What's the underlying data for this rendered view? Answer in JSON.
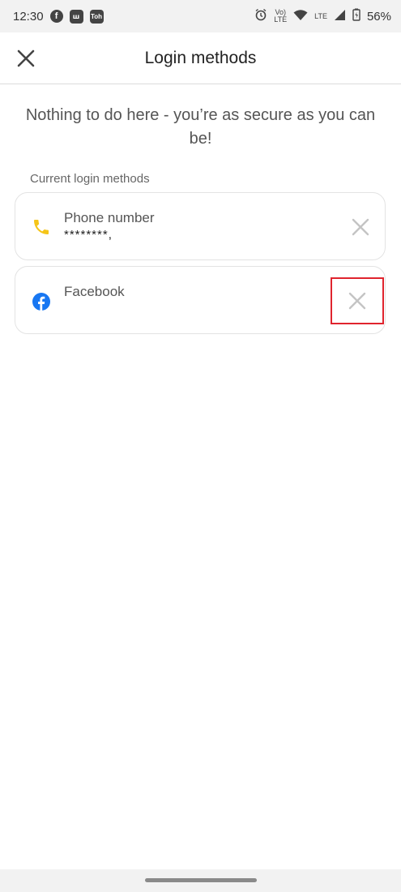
{
  "status_bar": {
    "time": "12:30",
    "fb_badge": "f",
    "app_badge_1": "ꟺ",
    "app_badge_2": "Toh",
    "volte_top": "Vo)",
    "volte_bottom": "LTE",
    "lte": "LTE",
    "battery": "56%"
  },
  "header": {
    "title": "Login methods"
  },
  "message": "Nothing to do here - you’re as secure as you can be!",
  "section_label": "Current login methods",
  "methods": [
    {
      "title": "Phone number",
      "value": "********,",
      "icon": "phone-icon",
      "icon_color": "#f5c518"
    },
    {
      "title": "Facebook",
      "value": "",
      "icon": "facebook-icon",
      "icon_color": "#1877f2"
    }
  ],
  "colors": {
    "highlight": "#e0242e",
    "remove_icon": "#c4c4c4"
  }
}
